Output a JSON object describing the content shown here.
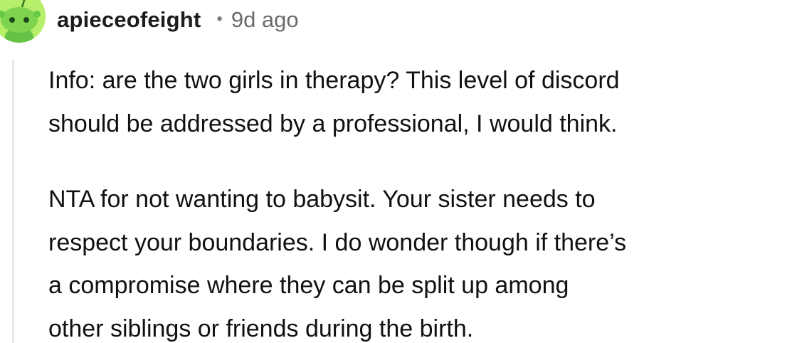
{
  "comment": {
    "username": "apieceofeight",
    "separator": "•",
    "timestamp": "9d ago",
    "avatar_icon": "snoo-avatar-icon",
    "avatar_color": "#b7ef6a",
    "paragraphs": [
      [
        "Info: are the two girls in therapy? This level of discord",
        "should be addressed by a professional, I would think."
      ],
      [
        "NTA for not wanting to babysit. Your sister needs to",
        "respect your boundaries. I do wonder though if there’s",
        "a compromise where they can be split up among",
        "other siblings or friends during the birth."
      ]
    ]
  }
}
